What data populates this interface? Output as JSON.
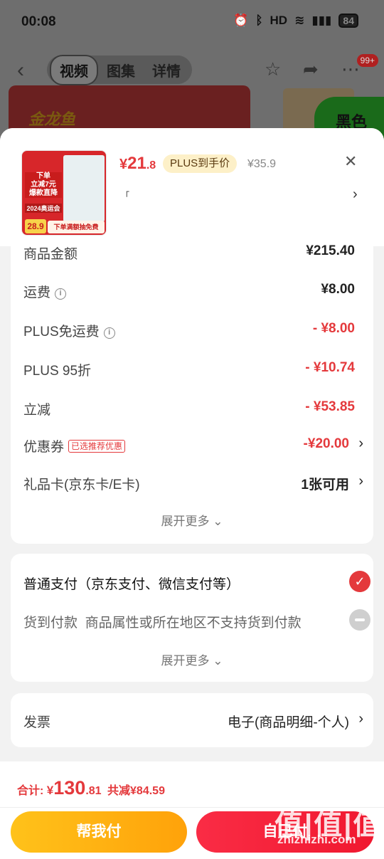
{
  "status_bar": {
    "time": "00:08",
    "icons": [
      "alarm-icon",
      "bluetooth-icon",
      "hd-icon",
      "wifi-icon",
      "5g-signal-icon"
    ],
    "hd": "HD",
    "battery": "84"
  },
  "nav": {
    "tabs": [
      "视频",
      "图集",
      "详情"
    ],
    "active_tab": 0,
    "badge": "99+"
  },
  "background": {
    "logo": "金龙鱼",
    "tag": "黑色"
  },
  "product": {
    "thumb": {
      "line1": "下单",
      "line2": "立减7元",
      "line3": "爆款直降",
      "line4": "2024奥运会",
      "price": "28.9",
      "free": "下单满额抽免费"
    },
    "price_symbol": "¥",
    "price_int": "21",
    "price_dec": ".8",
    "plus_tag": "PLUS到手价",
    "original_price": "¥35.9",
    "spec": "「"
  },
  "summary": {
    "rows": [
      {
        "label": "商品金额",
        "value": "¥215.40"
      },
      {
        "label": "运费",
        "value": "¥8.00",
        "info": true
      },
      {
        "label": "PLUS免运费",
        "value": "- ¥8.00",
        "info": true,
        "red": true
      },
      {
        "label": "PLUS 95折",
        "value": "- ¥10.74",
        "red": true
      },
      {
        "label": "立减",
        "value": "- ¥53.85",
        "red": true
      },
      {
        "label": "优惠券",
        "tag": "已选推荐优惠",
        "value": "-¥20.00",
        "red": true,
        "chevron": true
      },
      {
        "label": "礼品卡(京东卡/E卡)",
        "value": "1张可用",
        "chevron": true
      }
    ],
    "expand": "展开更多"
  },
  "payment": {
    "normal": "普通支付（京东支付、微信支付等）",
    "cod_label": "货到付款",
    "cod_note": "商品属性或所在地区不支持货到付款",
    "expand": "展开更多"
  },
  "invoice": {
    "label": "发票",
    "value": "电子(商品明细-个人)"
  },
  "footer": {
    "total_label": "合计:",
    "symbol": "¥",
    "total_int": "130",
    "total_dec": ".81",
    "saved": "共减¥84.59",
    "help_pay": "帮我付",
    "self_pay": "自己付",
    "watermark": "值|值|值",
    "watermark_sub": "zhizhizhi.com"
  },
  "colors": {
    "accent_red": "#e4393c",
    "help_btn": "#ffb012",
    "pay_btn": "#f5213a"
  }
}
